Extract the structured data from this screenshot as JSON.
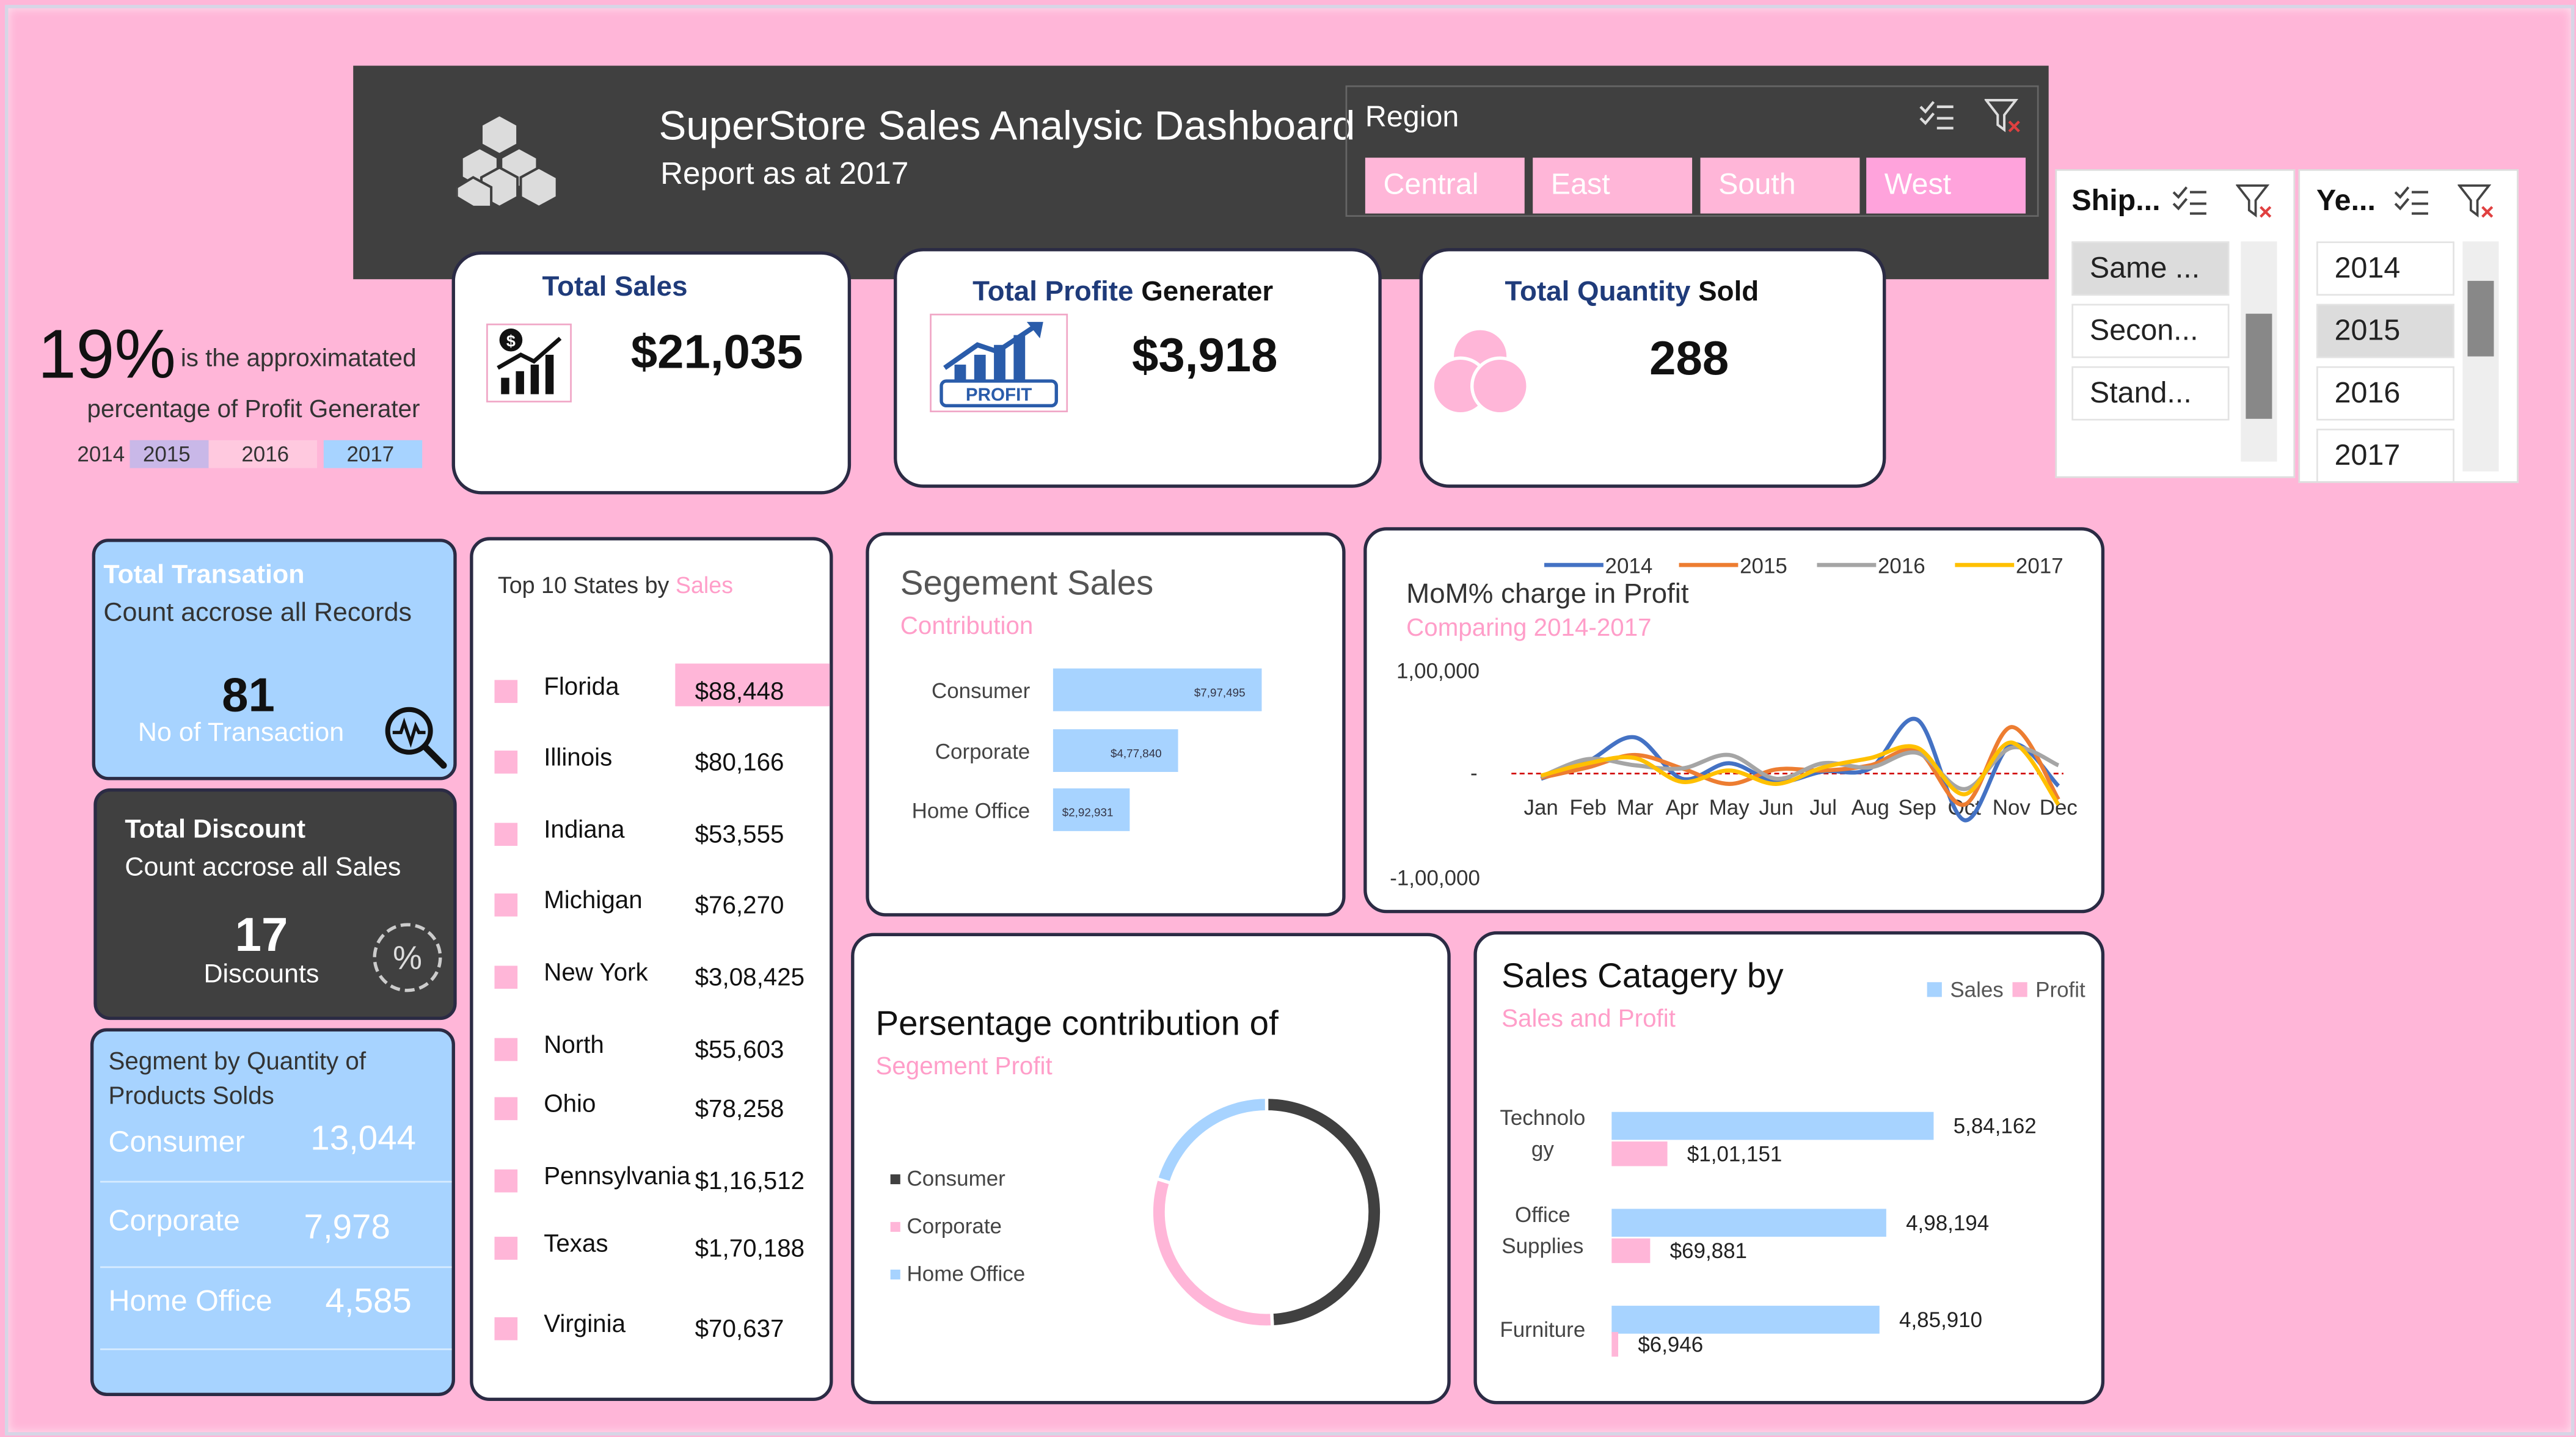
{
  "header": {
    "title": "SuperStore Sales Analysic Dashboard",
    "subtitle": "Report as at 2017"
  },
  "region_slicer": {
    "title": "Region",
    "items": [
      "Central",
      "East",
      "South",
      "West"
    ],
    "selected": "West"
  },
  "ship_slicer": {
    "title": "Ship...",
    "items": [
      "Same ...",
      "Secon...",
      "Stand..."
    ],
    "selected": "Same ..."
  },
  "year_slicer": {
    "title": "Ye...",
    "items": [
      "2014",
      "2015",
      "2016",
      "2017"
    ],
    "selected": "2015"
  },
  "profit_pct": {
    "value": "19%",
    "text1": "is the approximatated",
    "text2": "percentage of Profit Generater",
    "years": [
      "2014",
      "2015",
      "2016",
      "2017"
    ],
    "year_colors": [
      "#ffb6d8",
      "#c9b8e8",
      "#ffc9df",
      "#a7d3ff"
    ]
  },
  "kpis": {
    "sales": {
      "title": "Total Sales",
      "value": "$21,035"
    },
    "profit": {
      "title_a": "Total Profite",
      "title_b": "Generater",
      "value": "$3,918",
      "icon_text": "PROFIT"
    },
    "quantity": {
      "title_a": "Total Quantity",
      "title_b": "Sold",
      "value": "288"
    }
  },
  "transaction": {
    "title": "Total Transation",
    "subtitle": "Count accrose all Records",
    "value": "81",
    "label": "No of Transaction"
  },
  "discount": {
    "title": "Total Discount",
    "subtitle": "Count accrose all Sales",
    "value": "17",
    "label": "Discounts",
    "icon_text": "%"
  },
  "segment_qty": {
    "title_1": "Segment by Quantity  of",
    "title_2": "Products Solds",
    "rows": [
      {
        "name": "Consumer",
        "value": "13,044"
      },
      {
        "name": "Corporate",
        "value": "7,978"
      },
      {
        "name": "Home Office",
        "value": "4,585"
      }
    ]
  },
  "top_states": {
    "title": "Top 10 States by",
    "title_hl": "Sales",
    "rows": [
      {
        "state": "Florida",
        "value": "$88,448"
      },
      {
        "state": "Illinois",
        "value": "$80,166"
      },
      {
        "state": "Indiana",
        "value": "$53,555"
      },
      {
        "state": "Michigan",
        "value": "$76,270"
      },
      {
        "state": "New York",
        "value": "$3,08,425"
      },
      {
        "state": "North",
        "value": "$55,603"
      },
      {
        "state": "Ohio",
        "value": "$78,258"
      },
      {
        "state": "Pennsylvania",
        "value": "$1,16,512"
      },
      {
        "state": "Texas",
        "value": "$1,70,188"
      },
      {
        "state": "Virginia",
        "value": "$70,637"
      }
    ]
  },
  "segment_sales": {
    "title": "Segement Sales",
    "subtitle": "Contribution"
  },
  "mom": {
    "title": "MoM% charge in Profit",
    "subtitle": "Comparing 2014-2017"
  },
  "donut": {
    "title": "Persentage contribution of",
    "subtitle": "Segement Profit"
  },
  "cat": {
    "title": "Sales Catagery by",
    "subtitle": "Sales and Profit"
  },
  "chart_data": [
    {
      "type": "bar",
      "categories": [
        "Consumer",
        "Corporate",
        "Home Office"
      ],
      "values": [
        797495,
        477840,
        292931
      ],
      "value_labels": [
        "$7,97,495",
        "$4,77,840",
        "$2,92,931"
      ],
      "color": "#a7d3ff"
    },
    {
      "type": "line",
      "x": [
        "Jan",
        "Feb",
        "Mar",
        "Apr",
        "May",
        "Jun",
        "Jul",
        "Aug",
        "Sep",
        "Oct",
        "Nov",
        "Dec"
      ],
      "ylim": [
        -100000,
        100000
      ],
      "yticks": [
        "1,00,000",
        "-",
        "-1,00,000"
      ],
      "series": [
        {
          "name": "2014",
          "color": "#4472c4",
          "values": [
            -5000,
            12000,
            35000,
            -5000,
            10000,
            -8000,
            2000,
            5000,
            52000,
            -45000,
            28000,
            -12000
          ]
        },
        {
          "name": "2015",
          "color": "#ed7d31",
          "values": [
            -4000,
            6000,
            18000,
            5000,
            -10000,
            4000,
            3000,
            8000,
            22000,
            -30000,
            45000,
            -25000
          ]
        },
        {
          "name": "2016",
          "color": "#a5a5a5",
          "values": [
            -3000,
            14000,
            8000,
            5000,
            18000,
            -5000,
            10000,
            6000,
            20000,
            -15000,
            25000,
            8000
          ]
        },
        {
          "name": "2017",
          "color": "#ffc000",
          "values": [
            -2000,
            10000,
            15000,
            -8000,
            3000,
            -10000,
            6000,
            15000,
            25000,
            -20000,
            30000,
            -30000
          ]
        }
      ],
      "legend": "top",
      "reference_line": 0
    },
    {
      "type": "pie",
      "categories": [
        "Consumer",
        "Corporate",
        "Home Office"
      ],
      "values": [
        49.2,
        30.5,
        20.3
      ],
      "colors": [
        "#404040",
        "#ffb6d8",
        "#a7d3ff"
      ],
      "hole": true,
      "legend": "left"
    },
    {
      "type": "bar",
      "orientation": "horizontal",
      "categories": [
        "Technology",
        "Office Supplies",
        "Furniture"
      ],
      "category_lines": [
        [
          "Technolo",
          "gy"
        ],
        [
          "Office",
          "Supplies"
        ],
        [
          "Furniture"
        ]
      ],
      "series": [
        {
          "name": "Sales",
          "color": "#a7d3ff",
          "values": [
            584162,
            498194,
            485910
          ],
          "labels": [
            "5,84,162",
            "4,98,194",
            "4,85,910"
          ]
        },
        {
          "name": "Profit",
          "color": "#ffb6d8",
          "values": [
            101151,
            69881,
            6946
          ],
          "labels": [
            "$1,01,151",
            "$69,881",
            "$6,946"
          ]
        }
      ],
      "legend": "top-right"
    }
  ]
}
